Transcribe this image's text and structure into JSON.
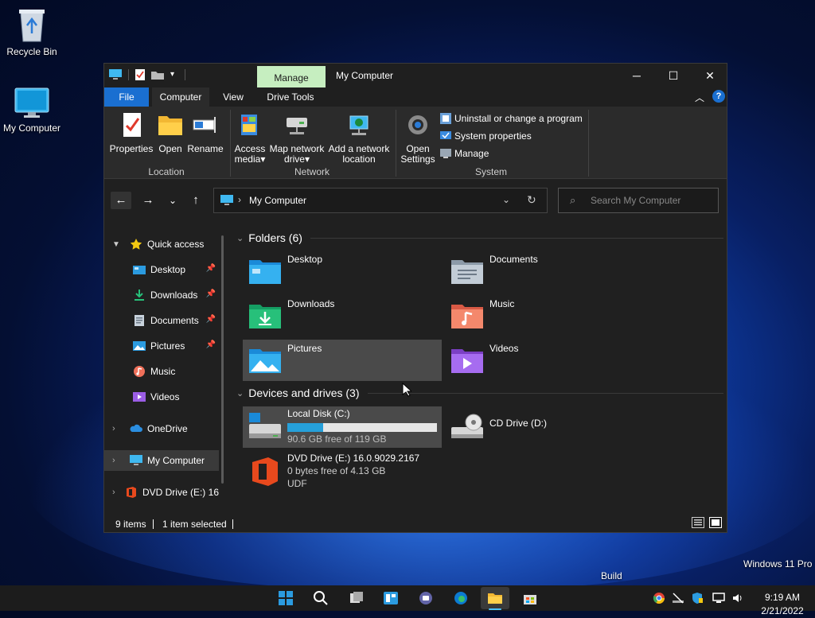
{
  "desktop": {
    "icons": [
      {
        "label": "Recycle Bin"
      },
      {
        "label": "My Computer"
      }
    ],
    "watermark": {
      "edition": "Windows 11 Pro",
      "build": "Build"
    }
  },
  "window": {
    "title": "My Computer",
    "contextual_tab": "Manage",
    "controls": {
      "minimize": "─",
      "maximize": "☐",
      "close": "✕"
    },
    "tabs": [
      {
        "label": "File"
      },
      {
        "label": "Computer"
      },
      {
        "label": "View"
      },
      {
        "label": "Drive Tools"
      }
    ],
    "ribbon": {
      "location": {
        "label": "Location",
        "buttons": [
          {
            "label": "Properties"
          },
          {
            "label": "Open"
          },
          {
            "label": "Rename"
          }
        ]
      },
      "network": {
        "label": "Network",
        "buttons": [
          {
            "label_line1": "Access",
            "label_line2": "media"
          },
          {
            "label_line1": "Map network",
            "label_line2": "drive"
          },
          {
            "label_line1": "Add a network",
            "label_line2": "location"
          }
        ]
      },
      "system": {
        "label": "System",
        "open_settings": {
          "label_line1": "Open",
          "label_line2": "Settings"
        },
        "commands": [
          {
            "label": "Uninstall or change a program"
          },
          {
            "label": "System properties"
          },
          {
            "label": "Manage"
          }
        ]
      }
    },
    "address": {
      "path": "My Computer"
    },
    "search": {
      "placeholder": "Search My Computer"
    },
    "sidebar": {
      "quick_access": "Quick access",
      "pinned": [
        {
          "label": "Desktop",
          "pinned": true
        },
        {
          "label": "Downloads",
          "pinned": true
        },
        {
          "label": "Documents",
          "pinned": true
        },
        {
          "label": "Pictures",
          "pinned": true
        },
        {
          "label": "Music",
          "pinned": false
        },
        {
          "label": "Videos",
          "pinned": false
        }
      ],
      "onedrive": "OneDrive",
      "my_computer": "My Computer",
      "dvd": "DVD Drive (E:) 16"
    },
    "folders": {
      "heading": "Folders (6)",
      "items": [
        {
          "label": "Desktop"
        },
        {
          "label": "Documents"
        },
        {
          "label": "Downloads"
        },
        {
          "label": "Music"
        },
        {
          "label": "Pictures"
        },
        {
          "label": "Videos"
        }
      ]
    },
    "drives": {
      "heading": "Devices and drives (3)",
      "local_disk": {
        "label": "Local Disk (C:)",
        "free": "90.6 GB free of 119 GB",
        "used_fraction": 0.24
      },
      "cd_drive": {
        "label": "CD Drive (D:)"
      },
      "dvd_drive": {
        "label": "DVD Drive (E:) 16.0.9029.2167",
        "free": "0 bytes free of 4.13 GB",
        "fs": "UDF"
      }
    },
    "status": {
      "items": "9 items",
      "selected": "1 item selected"
    }
  },
  "taskbar": {
    "clock": {
      "time": "9:19 AM",
      "date": "2/21/2022"
    }
  },
  "colors": {
    "accent": "#1a6fd1",
    "manage_tab": "#c6eec0",
    "progress": "#26a0da"
  }
}
